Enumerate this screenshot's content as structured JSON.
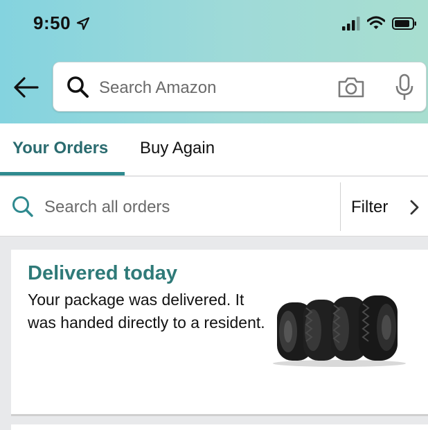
{
  "status_bar": {
    "time": "9:50",
    "location_icon": "location-arrow-icon",
    "signal_icon": "cellular-signal-icon",
    "wifi_icon": "wifi-icon",
    "battery_icon": "battery-icon"
  },
  "header": {
    "back_icon": "back-arrow-icon",
    "search": {
      "placeholder": "Search Amazon",
      "search_icon": "search-icon",
      "camera_icon": "camera-icon",
      "mic_icon": "microphone-icon"
    },
    "colors": {
      "gradient_start": "#84d3df",
      "gradient_end": "#a8ded0"
    }
  },
  "tabs": [
    {
      "label": "Your Orders",
      "active": true
    },
    {
      "label": "Buy Again",
      "active": false
    }
  ],
  "order_search": {
    "placeholder": "Search all orders",
    "filter_label": "Filter",
    "search_icon": "search-icon",
    "chevron_icon": "chevron-right-icon"
  },
  "orders": [
    {
      "status": "Delivered today",
      "description": "Your package was delivered. It was handed directly to a resident.",
      "image": "tires-product-image"
    }
  ],
  "accent": "#2f7a78"
}
